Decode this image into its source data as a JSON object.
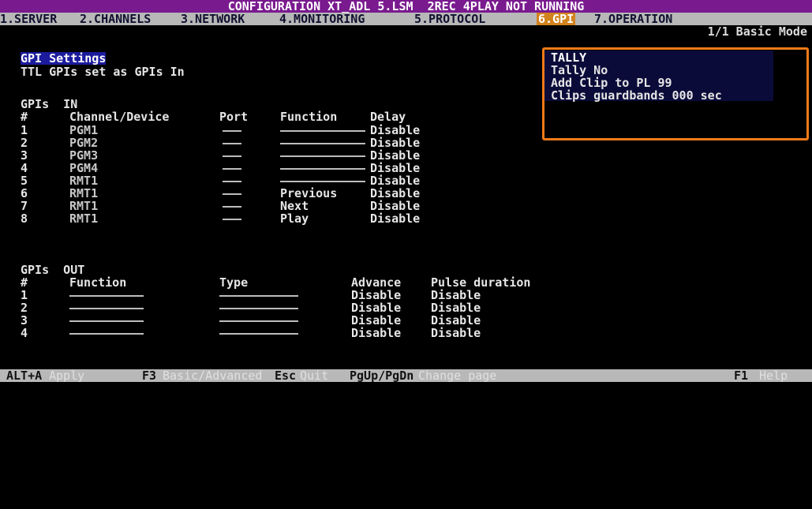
{
  "title_bar": {
    "text": "CONFIGURATION XT_ADL 5.LSM  2REC 4PLAY NOT RUNNING"
  },
  "menu": [
    {
      "label": "1.SERVER"
    },
    {
      "label": "2.CHANNELS"
    },
    {
      "label": "3.NETWORK"
    },
    {
      "label": "4.MONITORING"
    },
    {
      "label": "5.PROTOCOL"
    },
    {
      "label": "6.GPI",
      "active": true
    },
    {
      "label": "7.OPERATION"
    }
  ],
  "page_indicator": "1/1 Basic Mode",
  "gpi_settings": {
    "heading": "GPI Settings",
    "ttl_line": "TTL GPIs set as GPIs In"
  },
  "tally_panel": {
    "title": "TALLY",
    "tally": "Tally No",
    "add_clip": "Add Clip to PL 99",
    "guardbands": "Clips guardbands 000 sec"
  },
  "gpis_in": {
    "heading": "GPIs  IN",
    "columns": {
      "num": "#",
      "device": "Channel/Device",
      "port": "Port",
      "function": "Function",
      "delay": "Delay"
    },
    "rows": [
      {
        "num": "1",
        "device": "PGM1",
        "function": "",
        "delay": "Disable"
      },
      {
        "num": "2",
        "device": "PGM2",
        "function": "",
        "delay": "Disable"
      },
      {
        "num": "3",
        "device": "PGM3",
        "function": "",
        "delay": "Disable"
      },
      {
        "num": "4",
        "device": "PGM4",
        "function": "",
        "delay": "Disable"
      },
      {
        "num": "5",
        "device": "RMT1",
        "function": "",
        "delay": "Disable"
      },
      {
        "num": "6",
        "device": "RMT1",
        "function": "Previous",
        "delay": "Disable"
      },
      {
        "num": "7",
        "device": "RMT1",
        "function": "Next",
        "delay": "Disable"
      },
      {
        "num": "8",
        "device": "RMT1",
        "function": "Play",
        "delay": "Disable"
      }
    ]
  },
  "gpis_out": {
    "heading": "GPIs  OUT",
    "columns": {
      "num": "#",
      "function": "Function",
      "type": "Type",
      "advance": "Advance",
      "pulse": "Pulse duration"
    },
    "rows": [
      {
        "num": "1",
        "advance": "Disable",
        "pulse": "Disable"
      },
      {
        "num": "2",
        "advance": "Disable",
        "pulse": "Disable"
      },
      {
        "num": "3",
        "advance": "Disable",
        "pulse": "Disable"
      },
      {
        "num": "4",
        "advance": "Disable",
        "pulse": "Disable"
      }
    ]
  },
  "status_bar": [
    {
      "key": "ALT+A",
      "label": "Apply"
    },
    {
      "key": "F3",
      "label": "Basic/Advanced"
    },
    {
      "key": "Esc",
      "label": "Quit"
    },
    {
      "key": "PgUp/PgDn",
      "label": "Change page"
    },
    {
      "key": "F1",
      "label": "Help"
    }
  ]
}
